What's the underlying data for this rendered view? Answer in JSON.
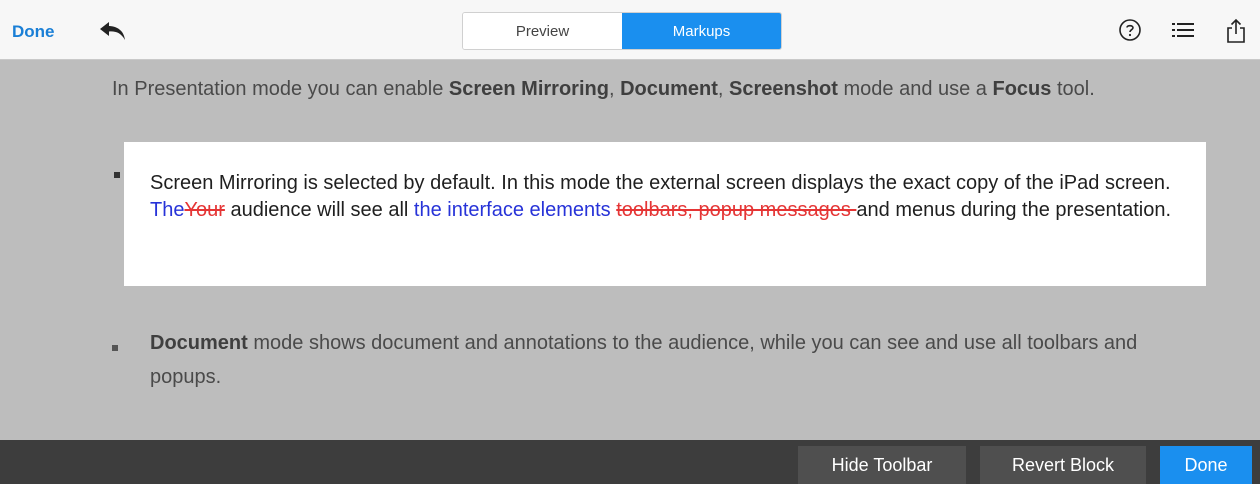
{
  "toolbar": {
    "done_label": "Done",
    "tabs": [
      {
        "label": "Preview",
        "active": false
      },
      {
        "label": "Markups",
        "active": true
      }
    ],
    "icons": [
      "undo-icon",
      "help-icon",
      "list-icon",
      "share-icon"
    ],
    "accent_color": "#1a8fef"
  },
  "document": {
    "intro": {
      "t1": "In Presentation mode you can enable ",
      "b1": "Screen Mirroring",
      "t2": ", ",
      "b2": "Document",
      "t3": ", ",
      "b3": "Screenshot",
      "t4": " mode and use a ",
      "b4": "Focus",
      "t5": " tool."
    },
    "focused_block": {
      "t1": "Screen Mirroring is selected by default. In this mode the external screen displays the exact copy of the iPad screen. ",
      "ins1": "The",
      "del1": "Your",
      "t2": " audience will see all ",
      "ins2": "the interface elements",
      "t3": " ",
      "del2": "toolbars, popup messages ",
      "t4": "and menus during the presentation."
    },
    "bullet2": {
      "b": "Document",
      "t": " mode shows document and annotations to the audience, while you can see and use all toolbars and popups."
    },
    "insert_color": "#2733d8",
    "delete_color": "#e53535"
  },
  "bottom_bar": {
    "hide_toolbar": "Hide Toolbar",
    "revert_block": "Revert Block",
    "done": "Done"
  }
}
